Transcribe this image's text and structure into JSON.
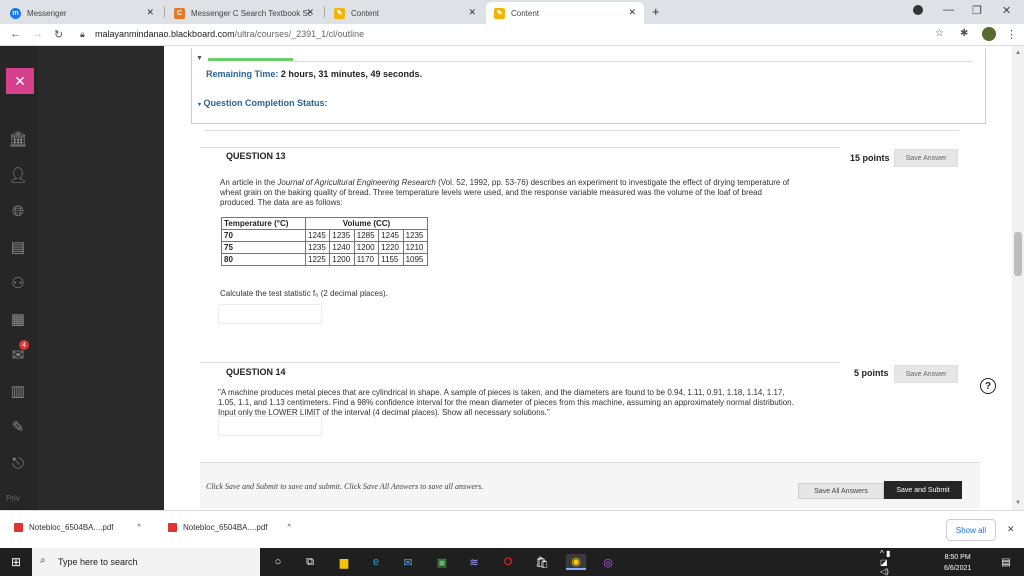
{
  "browser": {
    "tabs": [
      {
        "label": "Messenger"
      },
      {
        "label": "Messenger C Search Textbook Sc"
      },
      {
        "label": "Content"
      },
      {
        "label": "Content"
      }
    ],
    "url_domain": "malayanmindanao.blackboard.com",
    "url_path": "/ultra/courses/_2391_1/cl/outline"
  },
  "timer": {
    "label": "Remaining Time:",
    "hours": "2 hours,",
    "minutes": "31 minutes,",
    "seconds": "49 seconds.",
    "completion": "Question Completion Status:"
  },
  "q13": {
    "title": "QUESTION 13",
    "points": "15 points",
    "save": "Save Answer",
    "text_a": "An article in the ",
    "text_journal": "Journal of Agricultural Engineering Research",
    "text_b": " (Vol. 52, 1992, pp. 53-76) describes an experiment to investigate the effect of drying temperature of wheat grain on the baking quality of bread. Three temperature levels were used, and the response variable measured was the volume of the loaf of bread produced. The data are as follows:",
    "table_headers": [
      "Temperature (°C)",
      "Volume (CC)"
    ],
    "rows": [
      {
        "temp": "70",
        "vals": [
          "1245",
          "1235",
          "1285",
          "1245",
          "1235"
        ]
      },
      {
        "temp": "75",
        "vals": [
          "1235",
          "1240",
          "1200",
          "1220",
          "1210"
        ]
      },
      {
        "temp": "80",
        "vals": [
          "1225",
          "1200",
          "1170",
          "1155",
          "1095"
        ]
      }
    ],
    "prompt": "Calculate the test statistic f₀ (2 decimal places)."
  },
  "q14": {
    "title": "QUESTION 14",
    "points": "5 points",
    "save": "Save Answer",
    "text": "\"A machine produces metal pieces that are cylindrical in shape. A sample of pieces is taken, and the diameters are found to be 0.94, 1.11, 0.91, 1.18, 1.14, 1.17, 1.05, 1.1, and 1.13 centimeters. Find a 98% confidence interval for the mean diameter of pieces from this machine, assuming an approximately normal distribution. Input only the LOWER LIMIT of the interval (4 decimal places). Show all necessary solutions.\""
  },
  "footer": {
    "note": "Click Save and Submit to save and submit. Click Save All Answers to save all answers.",
    "save_all": "Save All Answers",
    "submit": "Save and Submit"
  },
  "sidebar": {
    "badge": "4",
    "privacy": "Priv"
  },
  "downloads": {
    "items": [
      "Notebloc_6504BA....pdf",
      "Notebloc_6504BA....pdf"
    ],
    "show_all": "Show all"
  },
  "taskbar": {
    "search_placeholder": "Type here to search",
    "time": "8:50 PM",
    "date": "6/6/2021"
  }
}
